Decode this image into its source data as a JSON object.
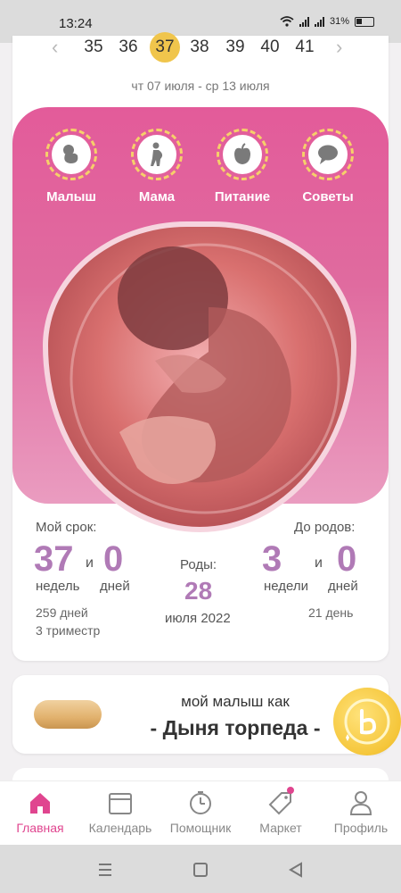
{
  "status_bar": {
    "time": "13:24",
    "battery": "31%"
  },
  "week_selector": {
    "weeks": [
      "35",
      "36",
      "37",
      "38",
      "39",
      "40",
      "41"
    ],
    "active_week": "37",
    "date_range": "чт 07 июля - ср 13 июля"
  },
  "categories": [
    {
      "label": "Малыш",
      "icon": "baby-icon"
    },
    {
      "label": "Мама",
      "icon": "pregnant-mother-icon"
    },
    {
      "label": "Питание",
      "icon": "apple-icon"
    },
    {
      "label": "Советы",
      "icon": "speech-bubble-icon"
    }
  ],
  "term": {
    "label": "Мой срок:",
    "weeks_value": "37",
    "and": "и",
    "days_value": "0",
    "weeks_unit": "недель",
    "days_unit": "дней",
    "total_days": "259 дней",
    "trimester": "3 триместр"
  },
  "due": {
    "label": "Роды:",
    "day": "28",
    "month_year": "июля 2022"
  },
  "remaining": {
    "label": "До родов:",
    "weeks_value": "3",
    "and": "и",
    "days_value": "0",
    "weeks_unit": "недели",
    "days_unit": "дней",
    "total_days": "21 день"
  },
  "fruit": {
    "caption": "мой малыш как",
    "name": "- Дыня торпеда -"
  },
  "tabs": [
    {
      "label": "Главная",
      "icon": "home-icon",
      "active": true
    },
    {
      "label": "Календарь",
      "icon": "calendar-icon",
      "active": false
    },
    {
      "label": "Помощник",
      "icon": "stopwatch-icon",
      "active": false
    },
    {
      "label": "Маркет",
      "icon": "price-tag-icon",
      "active": false
    },
    {
      "label": "Профиль",
      "icon": "person-icon",
      "active": false
    }
  ],
  "colors": {
    "accent_pink": "#e0458f",
    "panel_pink": "#e35b9a",
    "number_purple": "#b07ab6",
    "active_week_yellow": "#f0c54c"
  }
}
